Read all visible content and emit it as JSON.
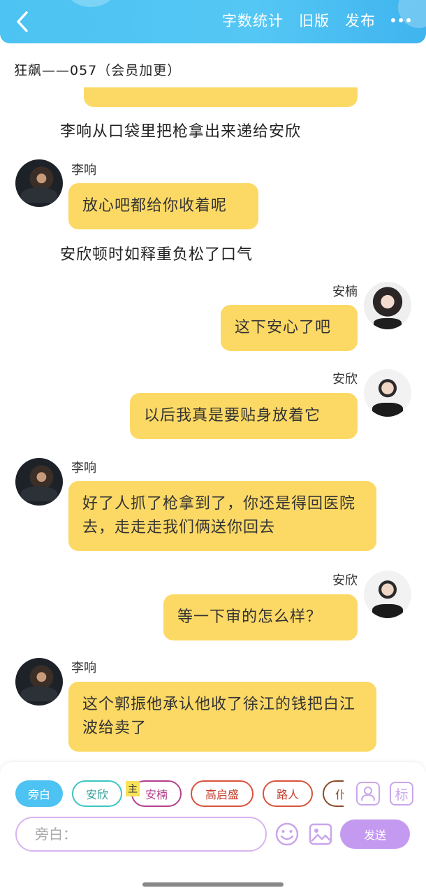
{
  "header": {
    "word_count_label": "字数统计",
    "old_version_label": "旧版",
    "publish_label": "发布"
  },
  "chapter": {
    "title": "狂飙——057（会员加更）"
  },
  "messages": [
    {
      "type": "narration",
      "text": "李响从口袋里把枪拿出来递给安欣"
    },
    {
      "type": "left",
      "speaker": "李响",
      "text": "放心吧都给你收着呢"
    },
    {
      "type": "narration",
      "text": "安欣顿时如释重负松了口气"
    },
    {
      "type": "right",
      "speaker": "安楠",
      "text": "这下安心了吧"
    },
    {
      "type": "right",
      "speaker": "安欣",
      "text": "以后我真是要贴身放着它"
    },
    {
      "type": "left",
      "speaker": "李响",
      "text": "好了人抓了枪拿到了，你还是得回医院去，走走走我们俩送你回去"
    },
    {
      "type": "right",
      "speaker": "安欣",
      "text": "等一下审的怎么样？"
    },
    {
      "type": "left",
      "speaker": "李响",
      "text": "这个郭振他承认他收了徐江的钱把白江波给卖了"
    }
  ],
  "composer": {
    "roles": [
      {
        "label": "旁白",
        "color": "#4cc3f2"
      },
      {
        "label": "安欣",
        "color": "#3cc7c0"
      },
      {
        "label": "安楠",
        "color": "#b5408e"
      },
      {
        "label": "高启盛",
        "color": "#d8533b"
      },
      {
        "label": "路人",
        "color": "#d8533b"
      },
      {
        "label": "仆",
        "color": "#8a4b2a"
      }
    ],
    "host_badge": "主",
    "tag_icon_label": "标",
    "input_placeholder": "旁白：",
    "send_label": "发送"
  }
}
